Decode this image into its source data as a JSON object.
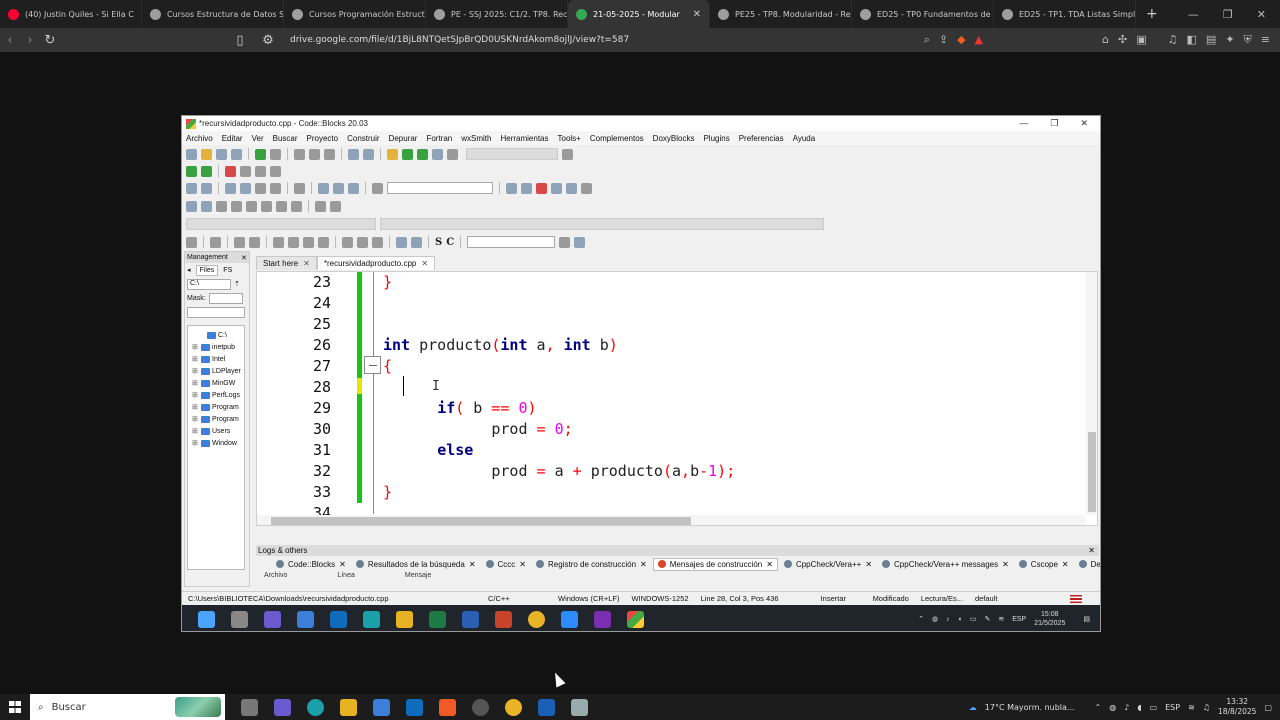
{
  "browser": {
    "tabs": [
      {
        "label": "(40) Justin Quiles - Si Ella C",
        "color": "#ff0033"
      },
      {
        "label": "Cursos Estructura de Datos SSJ",
        "color": "#9e9e9e"
      },
      {
        "label": "Cursos Programación Estructu",
        "color": "#9e9e9e"
      },
      {
        "label": "PE - SSJ 2025: C1/2. TP8. Recu",
        "color": "#9e9e9e"
      },
      {
        "label": "21-05-2025 - Modular",
        "color": "#34a853"
      },
      {
        "label": "PE25 - TP8. Modularidad - Rec",
        "color": "#9e9e9e"
      },
      {
        "label": "ED25 - TP0 Fundamentos de P",
        "color": "#9e9e9e"
      },
      {
        "label": "ED25 - TP1. TDA Listas Simple",
        "color": "#9e9e9e"
      }
    ],
    "active_tab": 4,
    "url": "drive.google.com/file/d/1BjL8NTQetSJpBrQD0USKNrdAkom8ojlJ/view?t=587"
  },
  "codeblocks": {
    "title": "*recursividadproducto.cpp - Code::Blocks 20.03",
    "menu": [
      "Archivo",
      "Editar",
      "Ver",
      "Buscar",
      "Proyecto",
      "Construir",
      "Depurar",
      "Fortran",
      "wxSmith",
      "Herramientas",
      "Tools+",
      "Complementos",
      "DoxyBlocks",
      "Plugins",
      "Preferencias",
      "Ayuda"
    ],
    "management": {
      "title": "Management",
      "tabs": [
        "Files",
        "FS"
      ],
      "drive": "C:\\",
      "mask_label": "Mask:",
      "tree": [
        "C:\\",
        "inetpub",
        "Intel",
        "LDPlayer",
        "MinGW",
        "PerfLogs",
        "Program",
        "Program",
        "Users",
        "Window"
      ]
    },
    "editor_tabs": [
      "Start here",
      "*recursividadproducto.cpp"
    ],
    "active_editor_tab": 1,
    "logs": {
      "title": "Logs & others",
      "tabs": [
        "Code::Blocks",
        "Resultados de la búsqueda",
        "Cccc",
        "Registro de construcción",
        "Mensajes de construcción",
        "CppCheck/Vera++",
        "CppCheck/Vera++ messages",
        "Cscope",
        "Depu"
      ],
      "active_tab": 4,
      "columns": [
        "Archivo",
        "Línea",
        "Mensaje"
      ]
    },
    "status": {
      "path": "C:\\Users\\BIBLIOTECA\\Downloads\\recursividadproducto.cpp",
      "language": "C/C++",
      "eol": "Windows (CR+LF)",
      "encoding": "WINDOWS-1252",
      "position": "Line 28, Col 3, Pos 436",
      "mode": "Insertar",
      "modified": "Modificado",
      "access": "Lectura/Es...",
      "profile": "default"
    },
    "inner_taskbar": {
      "lang": "ESP",
      "time": "15:08",
      "date": "21/5/2025"
    }
  },
  "code_lines": [
    {
      "num": "23",
      "indent": "",
      "tokens": [
        {
          "t": "}",
          "c": "brace"
        }
      ]
    },
    {
      "num": "24",
      "indent": "",
      "tokens": []
    },
    {
      "num": "25",
      "indent": "",
      "tokens": []
    },
    {
      "num": "26",
      "indent": "",
      "tokens": [
        {
          "t": "int",
          "c": "kw"
        },
        {
          "t": " producto",
          "c": ""
        },
        {
          "t": "(",
          "c": "punc"
        },
        {
          "t": "int",
          "c": "kw"
        },
        {
          "t": " a",
          "c": ""
        },
        {
          "t": ",",
          "c": "punc"
        },
        {
          "t": " ",
          "c": ""
        },
        {
          "t": "int",
          "c": "kw"
        },
        {
          "t": " b",
          "c": ""
        },
        {
          "t": ")",
          "c": "punc"
        }
      ]
    },
    {
      "num": "27",
      "indent": "",
      "tokens": [
        {
          "t": "{",
          "c": "brace"
        }
      ]
    },
    {
      "num": "28",
      "indent": "",
      "tokens": []
    },
    {
      "num": "29",
      "indent": "      ",
      "tokens": [
        {
          "t": "if",
          "c": "kw"
        },
        {
          "t": "(",
          "c": "punc"
        },
        {
          "t": " b ",
          "c": ""
        },
        {
          "t": "==",
          "c": "op"
        },
        {
          "t": " ",
          "c": ""
        },
        {
          "t": "0",
          "c": "num"
        },
        {
          "t": ")",
          "c": "punc"
        }
      ]
    },
    {
      "num": "30",
      "indent": "            ",
      "tokens": [
        {
          "t": "prod ",
          "c": ""
        },
        {
          "t": "=",
          "c": "op"
        },
        {
          "t": " ",
          "c": ""
        },
        {
          "t": "0",
          "c": "num"
        },
        {
          "t": ";",
          "c": "punc"
        }
      ]
    },
    {
      "num": "31",
      "indent": "      ",
      "tokens": [
        {
          "t": "else",
          "c": "kw"
        }
      ]
    },
    {
      "num": "32",
      "indent": "            ",
      "tokens": [
        {
          "t": "prod ",
          "c": ""
        },
        {
          "t": "=",
          "c": "op"
        },
        {
          "t": " a ",
          "c": ""
        },
        {
          "t": "+",
          "c": "op"
        },
        {
          "t": " producto",
          "c": ""
        },
        {
          "t": "(",
          "c": "punc"
        },
        {
          "t": "a",
          "c": ""
        },
        {
          "t": ",",
          "c": "punc"
        },
        {
          "t": "b",
          "c": ""
        },
        {
          "t": "-",
          "c": "op"
        },
        {
          "t": "1",
          "c": "num"
        },
        {
          "t": ")",
          "c": "punc"
        },
        {
          "t": ";",
          "c": "punc"
        }
      ]
    },
    {
      "num": "33",
      "indent": "",
      "tokens": [
        {
          "t": "}",
          "c": "brace"
        }
      ]
    },
    {
      "num": "34",
      "indent": "",
      "tokens": []
    }
  ],
  "taskbar": {
    "search_placeholder": "Buscar",
    "weather": "17°C  Mayorm. nubla...",
    "lang": "ESP",
    "time": "13:32",
    "date": "18/8/2025"
  }
}
